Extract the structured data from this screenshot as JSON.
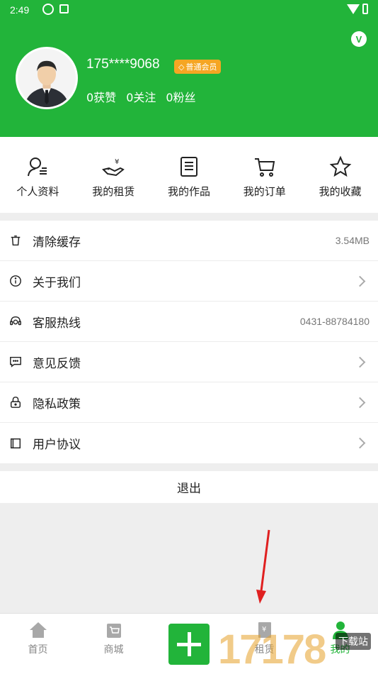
{
  "status": {
    "time": "2:49"
  },
  "profile": {
    "username": "175****9068",
    "member_label": "普通会员",
    "likes": "0获赞",
    "following": "0关注",
    "fans": "0粉丝"
  },
  "quick_menu": [
    {
      "label": "个人资料",
      "icon": "user-profile-icon"
    },
    {
      "label": "我的租赁",
      "icon": "rent-icon"
    },
    {
      "label": "我的作品",
      "icon": "works-icon"
    },
    {
      "label": "我的订单",
      "icon": "cart-icon"
    },
    {
      "label": "我的收藏",
      "icon": "star-icon"
    }
  ],
  "settings": [
    {
      "label": "清除缓存",
      "value": "3.54MB",
      "icon": "trash-icon"
    },
    {
      "label": "关于我们",
      "value": "",
      "icon": "info-icon"
    },
    {
      "label": "客服热线",
      "value": "0431-88784180",
      "icon": "headset-icon"
    },
    {
      "label": "意见反馈",
      "value": "",
      "icon": "feedback-icon"
    },
    {
      "label": "隐私政策",
      "value": "",
      "icon": "lock-icon"
    },
    {
      "label": "用户协议",
      "value": "",
      "icon": "book-icon"
    }
  ],
  "logout_label": "退出",
  "tabs": [
    {
      "label": "首页",
      "icon": "home-icon"
    },
    {
      "label": "商城",
      "icon": "shop-icon"
    },
    {
      "label": "租赁",
      "icon": "rent-tab-icon"
    },
    {
      "label": "我的",
      "icon": "person-icon"
    }
  ],
  "watermark": {
    "text": "17178",
    "sub": "下载站"
  },
  "colors": {
    "primary": "#22b43a",
    "badge": "#f5a623"
  }
}
